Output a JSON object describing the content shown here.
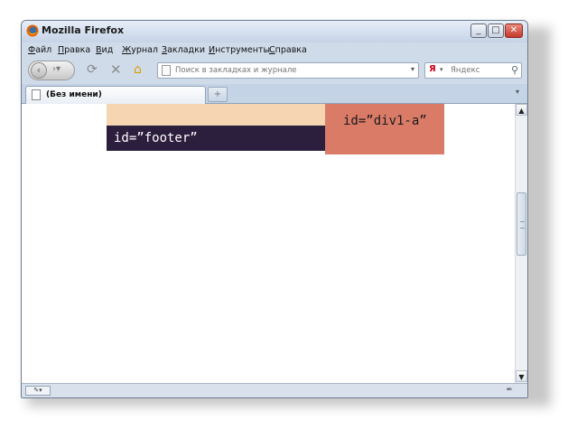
{
  "window": {
    "title": "Mozilla Firefox",
    "buttons": {
      "minimize": "_",
      "maximize": "□",
      "close": "✕"
    }
  },
  "menu": [
    "Файл",
    "Правка",
    "Вид",
    "Журнал",
    "Закладки",
    "Инструменты",
    "Справка"
  ],
  "nav": {
    "address_placeholder": "Поиск в закладках и журнале",
    "search_engine": "Я",
    "search_placeholder": "Яндекс"
  },
  "tabs": [
    {
      "label": "(Без имени)"
    }
  ],
  "page": {
    "footer_label": "id=”footer”",
    "div1a_label": "id=”div1-a”"
  },
  "colors": {
    "peach": "#f6d5b2",
    "footer": "#2c1f3e",
    "salmon": "#da7b68"
  }
}
